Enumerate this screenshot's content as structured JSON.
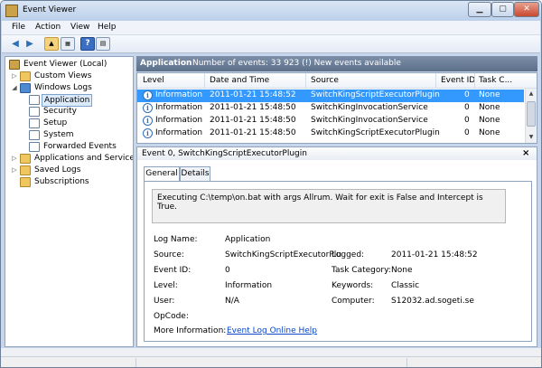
{
  "window": {
    "title": "Event Viewer"
  },
  "menu": {
    "file": "File",
    "action": "Action",
    "view": "View",
    "help": "Help"
  },
  "tree": {
    "root": "Event Viewer (Local)",
    "custom_views": "Custom Views",
    "windows_logs": "Windows Logs",
    "application": "Application",
    "security": "Security",
    "setup": "Setup",
    "system": "System",
    "forwarded": "Forwarded Events",
    "apps_services": "Applications and Services L",
    "saved_logs": "Saved Logs",
    "subscriptions": "Subscriptions"
  },
  "header": {
    "log_name": "Application",
    "summary": "Number of events: 33 923 (!) New events available"
  },
  "grid": {
    "columns": [
      "Level",
      "Date and Time",
      "Source",
      "Event ID",
      "Task C..."
    ],
    "rows": [
      {
        "level": "Information",
        "datetime": "2011-01-21 15:48:52",
        "source": "SwitchKingScriptExecutorPlugin",
        "event_id": "0",
        "task": "None"
      },
      {
        "level": "Information",
        "datetime": "2011-01-21 15:48:50",
        "source": "SwitchKingInvocationService",
        "event_id": "0",
        "task": "None"
      },
      {
        "level": "Information",
        "datetime": "2011-01-21 15:48:50",
        "source": "SwitchKingInvocationService",
        "event_id": "0",
        "task": "None"
      },
      {
        "level": "Information",
        "datetime": "2011-01-21 15:48:50",
        "source": "SwitchKingScriptExecutorPlugin",
        "event_id": "0",
        "task": "None"
      }
    ]
  },
  "detail": {
    "title": "Event 0, SwitchKingScriptExecutorPlugin",
    "close": "×",
    "tab_general": "General",
    "tab_details": "Details",
    "message": "Executing C:\\temp\\on.bat with args Allrum. Wait for exit is False and Intercept is True.",
    "labels": {
      "log_name": "Log Name:",
      "source": "Source:",
      "event_id": "Event ID:",
      "level": "Level:",
      "user": "User:",
      "opcode": "OpCode:",
      "more_info": "More Information:",
      "logged": "Logged:",
      "task_category": "Task Category:",
      "keywords": "Keywords:",
      "computer": "Computer:"
    },
    "values": {
      "log_name": "Application",
      "source": "SwitchKingScriptExecutorPlu",
      "event_id": "0",
      "level": "Information",
      "user": "N/A",
      "opcode": "",
      "more_info_link": "Event Log Online Help",
      "logged": "2011-01-21 15:48:52",
      "task_category": "None",
      "keywords": "Classic",
      "computer": "S12032.ad.sogeti.se"
    }
  }
}
